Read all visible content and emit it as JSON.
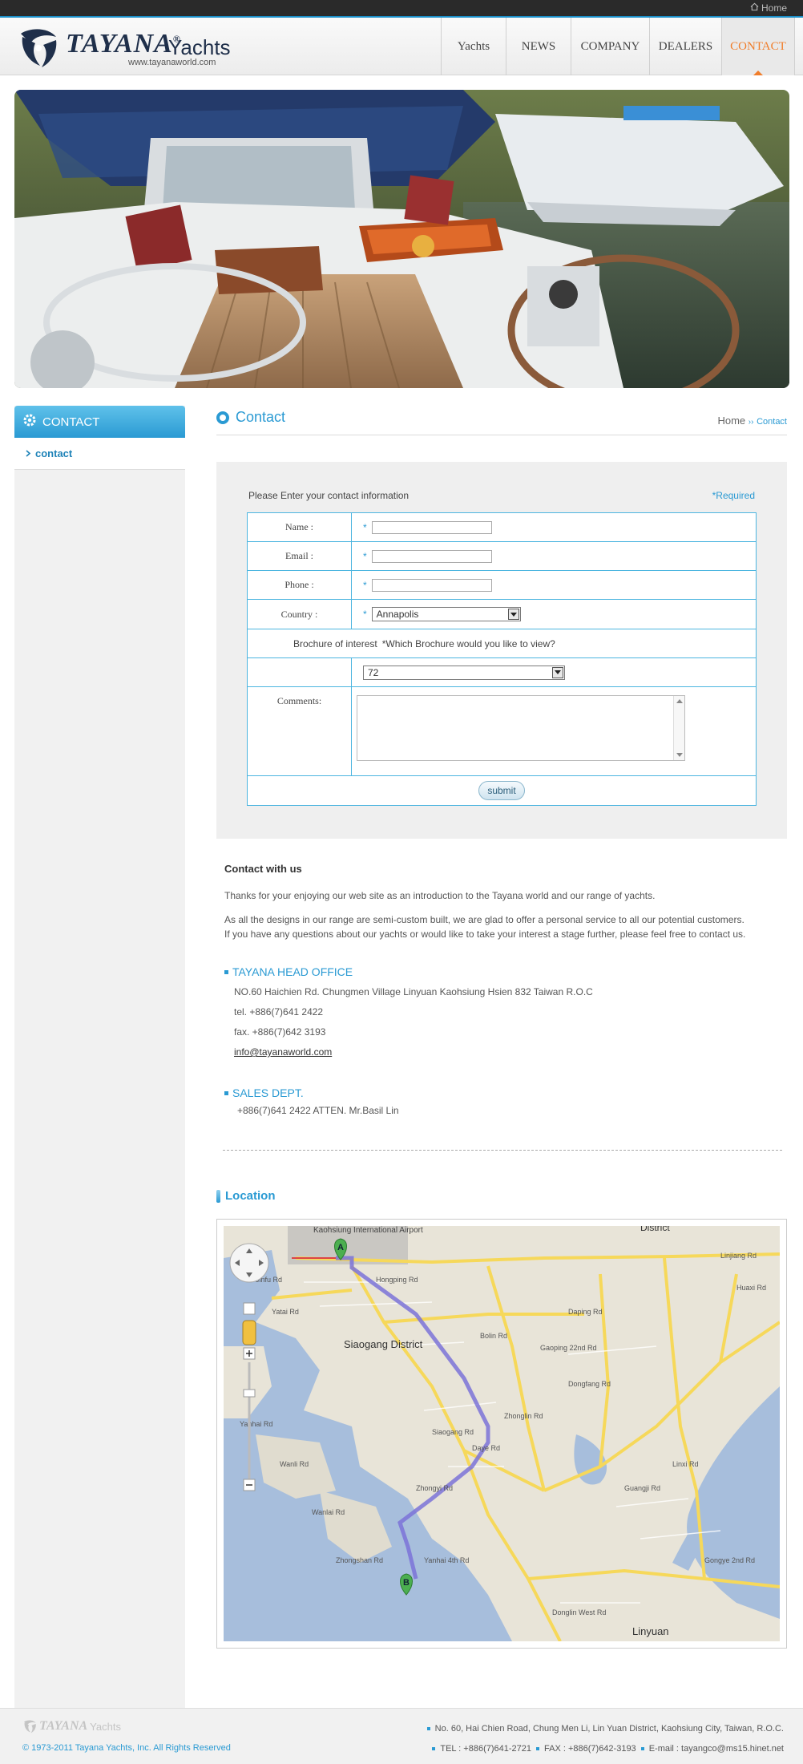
{
  "topbar": {
    "home_label": "Home"
  },
  "logo": {
    "brand": "TAYANA",
    "yachts": "Yachts",
    "url": "www.tayanaworld.com",
    "registered": "®"
  },
  "nav": [
    {
      "label": "Yachts",
      "active": false
    },
    {
      "label": "NEWS",
      "active": false
    },
    {
      "label": "COMPANY",
      "active": false
    },
    {
      "label": "DEALERS",
      "active": false
    },
    {
      "label": "CONTACT",
      "active": true
    }
  ],
  "sidebar": {
    "title": "CONTACT",
    "items": [
      {
        "label": "contact"
      }
    ]
  },
  "page": {
    "title": "Contact",
    "breadcrumb": {
      "home": "Home",
      "separator": "››",
      "current": "Contact"
    }
  },
  "form": {
    "intro": "Please Enter your contact information",
    "required_note": "*Required",
    "required_mark": "*",
    "fields": {
      "name": {
        "label": "Name :",
        "value": ""
      },
      "email": {
        "label": "Email :",
        "value": ""
      },
      "phone": {
        "label": "Phone :",
        "value": ""
      },
      "country": {
        "label": "Country :",
        "value": "Annapolis"
      }
    },
    "brochure": {
      "label": "Brochure of interest",
      "question": "*Which Brochure would you like to view?",
      "value": "72"
    },
    "comments": {
      "label": "Comments:",
      "value": ""
    },
    "submit_label": "submit"
  },
  "contact": {
    "heading": "Contact with us",
    "para1": "Thanks for your enjoying our web site as an introduction to the Tayana world and our range of yachts.",
    "para2a": "As all the designs in our range are semi-custom built, we are glad to offer a personal service to all our potential customers.",
    "para2b": "If you have any questions about our yachts or would like to take your interest a stage further, please feel free to contact us.",
    "head_office": {
      "title": "TAYANA HEAD OFFICE",
      "address": "NO.60 Haichien Rd. Chungmen Village Linyuan Kaohsiung Hsien 832 Taiwan R.O.C",
      "tel": "tel. +886(7)641 2422",
      "fax": "fax. +886(7)642 3193",
      "email": "info@tayanaworld.com"
    },
    "sales": {
      "title": "SALES DEPT.",
      "line": "+886(7)641 2422  ATTEN. Mr.Basil Lin"
    }
  },
  "location": {
    "title": "Location",
    "map": {
      "labels": {
        "airport": "Kaohsiung International Airport",
        "district": "Siaogang District",
        "district_top": "District",
        "linyuan": "Linyuan",
        "marker_a": "A",
        "marker_b": "B",
        "roads": [
          "Jinfu Rd",
          "Yatai Rd",
          "Hongping Rd",
          "Zhongyi Rd",
          "Daye Rd",
          "Bolin Rd",
          "Zhonglin Rd",
          "Daping Rd",
          "Dongfang Rd",
          "Linxi Rd",
          "Yanhai Rd",
          "Zhongshan Rd",
          "Wanlai Rd",
          "Wanli Rd",
          "Donglin West Rd",
          "Gongye 2nd Rd",
          "Huaxi Rd",
          "Linjiang Rd",
          "Guangji Rd",
          "Siaogang Rd",
          "Gaoping 22nd Rd",
          "Yanhai 4th Rd"
        ]
      }
    }
  },
  "footer": {
    "logo_text": "TAYANA",
    "logo_yachts": "Yachts",
    "copyright": "© 1973-2011 Tayana Yachts, Inc. All Rights Reserved",
    "address": "No. 60, Hai Chien Road, Chung Men Li, Lin Yuan District, Kaohsiung City, Taiwan, R.O.C.",
    "tel": "TEL : +886(7)641-2721",
    "fax": "FAX : +886(7)642-3193",
    "email": "E-mail : tayangco@ms15.hinet.net"
  },
  "colors": {
    "accent": "#2a9ad3",
    "nav_active": "#f07d2a",
    "topbar": "#2a2a2a"
  },
  "icons": {
    "home": "home-icon",
    "sidebar_title": "gear-icon",
    "sidebar_item": "chevron-right-icon"
  }
}
